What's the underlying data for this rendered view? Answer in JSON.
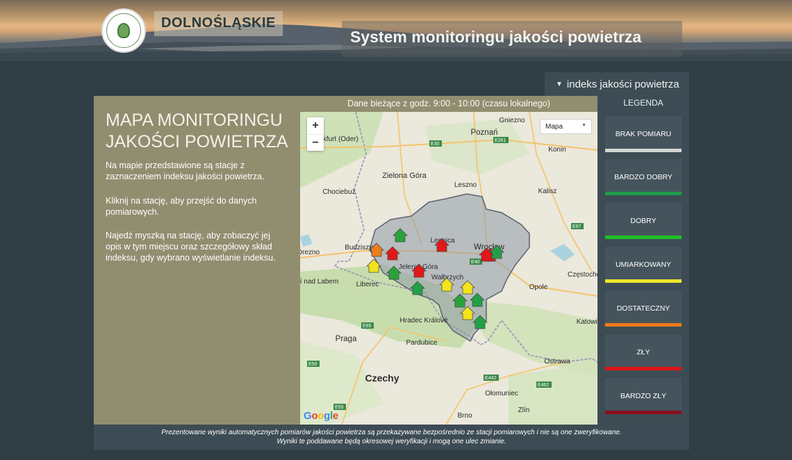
{
  "header": {
    "logo_alt": "WOJEWÓDZKI INSPEKTORAT OCHRONY ŚRODOWISKA WROCŁAW",
    "region": "DOLNOŚLĄSKIE",
    "system_title": "System monitoringu jakości powietrza"
  },
  "index_selector": {
    "label": "indeks jakości powietrza"
  },
  "panel": {
    "title": "MAPA MONITORINGU JAKOŚCI POWIETRZA",
    "paragraphs": [
      "Na mapie przedstawione są stacje z zaznaczeniem indeksu jakości powietrza.",
      "Kliknij na stację, aby przejść do danych pomiarowych.",
      "Najedź myszką na stację, aby zobaczyć jej opis w tym miejscu oraz szczegółowy skład indeksu, gdy wybrano wyświetlanie indeksu."
    ],
    "current_data": "Dane bieżące z godz. 9:00 - 10:00 (czasu lokalnego)"
  },
  "map": {
    "zoom_in": "+",
    "zoom_out": "−",
    "type_selector": "Mapa",
    "attribution": "Google",
    "place_labels": [
      "Gniezno",
      "Poznań",
      "Frankfurt (Oder)",
      "Konin",
      "Zielona Góra",
      "Leszno",
      "Chociebuż",
      "Kalisz",
      "Legnica",
      "Wrocław",
      "Budziszyn",
      "Jelenia Góra",
      "Wałbrzych",
      "Liberec",
      "Opole",
      "Ústí nad Labem",
      "Hradec Králové",
      "Praga",
      "Pardubice",
      "Czechy",
      "Ostrawa",
      "Ołomuniec",
      "Brno",
      "Zlín",
      "Katowice",
      "Częstochowa",
      "Drezno"
    ],
    "road_labels": [
      "E30",
      "E261",
      "E67",
      "E65",
      "E40",
      "E442",
      "E462",
      "E50",
      "E55"
    ],
    "stations": [
      {
        "index": "dobry",
        "color": "#2aa23a"
      },
      {
        "index": "dostateczny",
        "color": "#ea7d1e"
      },
      {
        "index": "zły",
        "color": "#e11818"
      },
      {
        "index": "umiarkowany",
        "color": "#f2e31c"
      },
      {
        "index": "zły",
        "color": "#e11818"
      },
      {
        "index": "zły",
        "color": "#e11818"
      },
      {
        "index": "dobry",
        "color": "#2aa23a"
      },
      {
        "index": "zły",
        "color": "#e11818"
      },
      {
        "index": "bardzo dobry",
        "color": "#22a047"
      },
      {
        "index": "umiarkowany",
        "color": "#f2e31c"
      },
      {
        "index": "umiarkowany",
        "color": "#f2e31c"
      },
      {
        "index": "zły",
        "color": "#e11818"
      },
      {
        "index": "bardzo dobry",
        "color": "#22a047"
      },
      {
        "index": "dobry",
        "color": "#2aa23a"
      },
      {
        "index": "bardzo dobry",
        "color": "#22a047"
      },
      {
        "index": "umiarkowany",
        "color": "#f2e31c"
      },
      {
        "index": "bardzo dobry",
        "color": "#22a047"
      }
    ]
  },
  "legend": {
    "title": "LEGENDA",
    "items": [
      {
        "label": "BRAK POMIARU",
        "color": "#d3d6d4"
      },
      {
        "label": "BARDZO DOBRY",
        "color": "#1c9e4a"
      },
      {
        "label": "DOBRY",
        "color": "#1fbf2a"
      },
      {
        "label": "UMIARKOWANY",
        "color": "#ece62a"
      },
      {
        "label": "DOSTATECZNY",
        "color": "#ee7a1d"
      },
      {
        "label": "ZŁY",
        "color": "#e01515"
      },
      {
        "label": "BARDZO ZŁY",
        "color": "#8a0f1c"
      }
    ]
  },
  "footer": {
    "line1": "Prezentowane wyniki automatycznych pomiarów jakości powietrza są przekazywane bezpośrednio ze stacji pomiarowych i nie są one zweryfikowane.",
    "line2": "Wyniki te poddawane będą okresowej weryfikacji i mogą one ulec zmianie."
  }
}
